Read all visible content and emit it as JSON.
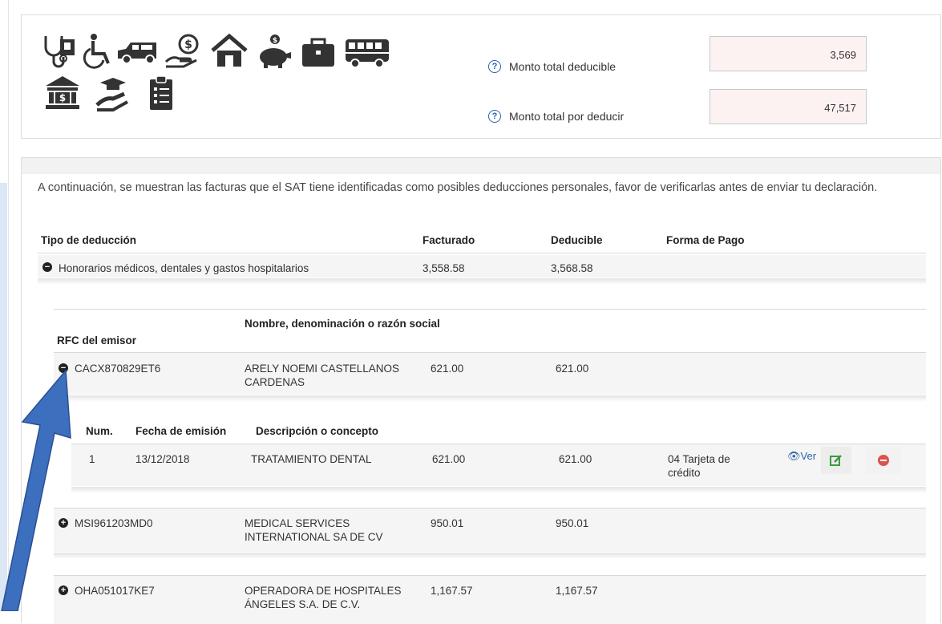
{
  "summary": {
    "icons": [
      "stethoscope-icon",
      "wheelchair-icon",
      "hearse-icon",
      "hand-coin-icon",
      "house-icon",
      "piggy-bank-icon",
      "briefcase-icon",
      "school-bus-icon",
      "bank-icon",
      "graduation-hand-icon",
      "clipboard-icon"
    ],
    "total_deducible_label": "Monto total deducible",
    "total_deducible_value": "3,569",
    "total_por_deducir_label": "Monto total por deducir",
    "total_por_deducir_value": "47,517"
  },
  "intro_text": "A continuación, se muestran las facturas que el SAT tiene identificadas como posibles deducciones personales, favor de verificarlas antes de enviar tu declaración.",
  "deductions_table": {
    "headers": {
      "tipo": "Tipo de deducción",
      "facturado": "Facturado",
      "deducible": "Deducible",
      "forma_pago": "Forma de Pago"
    },
    "row": {
      "tipo": "Honorarios médicos, dentales y gastos hospitalarios",
      "facturado": "3,558.58",
      "deducible": "3,568.58"
    }
  },
  "emisor_table": {
    "headers": {
      "rfc": "RFC del emisor",
      "nombre": "Nombre, denominación o razón social"
    },
    "rows": [
      {
        "rfc": "CACX870829ET6",
        "nombre": "ARELY NOEMI CASTELLANOS CARDENAS",
        "facturado": "621.00",
        "deducible": "621.00"
      },
      {
        "rfc": "MSI961203MD0",
        "nombre": "MEDICAL SERVICES INTERNATIONAL SA DE CV",
        "facturado": "950.01",
        "deducible": "950.01"
      },
      {
        "rfc": "OHA051017KE7",
        "nombre": "OPERADORA DE HOSPITALES ÁNGELES S.A. DE C.V.",
        "facturado": "1,167.57",
        "deducible": "1,167.57"
      }
    ]
  },
  "invoice_table": {
    "headers": {
      "num": "Num.",
      "fecha": "Fecha de emisión",
      "descripcion": "Descripción o concepto"
    },
    "row": {
      "num": "1",
      "fecha": "13/12/2018",
      "descripcion": "TRATAMIENTO DENTAL",
      "facturado": "621.00",
      "deducible": "621.00",
      "forma_pago": "04 Tarjeta de crédito",
      "ver": "Ver"
    }
  },
  "colors": {
    "accent": "#2a62ad",
    "arrow": "#3d6fbf",
    "delete": "#d9534f",
    "edit": "#3c9a3c",
    "box_bg": "#fcf2f2"
  }
}
